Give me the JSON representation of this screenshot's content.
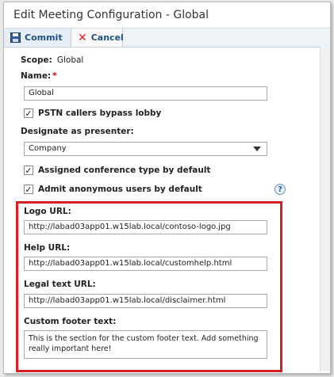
{
  "window": {
    "title": "Edit Meeting Configuration - Global"
  },
  "toolbar": {
    "commit_label": "Commit",
    "cancel_label": "Cancel"
  },
  "form": {
    "scope_label": "Scope:",
    "scope_value": "Global",
    "name_label": "Name:",
    "name_required_mark": "*",
    "name_value": "Global",
    "pstn_bypass": {
      "label": "PSTN callers bypass lobby",
      "checked": true
    },
    "designate_label": "Designate as presenter:",
    "designate_value": "Company",
    "assigned_conf": {
      "label": "Assigned conference type by default",
      "checked": true
    },
    "admit_anon": {
      "label": "Admit anonymous users by default",
      "checked": true
    },
    "help_glyph": "?",
    "logo_url_label": "Logo URL:",
    "logo_url_value": "http://labad03app01.w15lab.local/contoso-logo.jpg",
    "help_url_label": "Help URL:",
    "help_url_value": "http://labad03app01.w15lab.local/customhelp.html",
    "legal_url_label": "Legal text URL:",
    "legal_url_value": "http://labad03app01.w15lab.local/disclaimer.html",
    "footer_label": "Custom footer text:",
    "footer_value": "This is the section for the custom footer text.  Add something really important here!"
  },
  "colors": {
    "highlight": "#d81f26",
    "toolbar_text": "#1f4f86",
    "required": "#cc0000"
  },
  "icons": {
    "commit": "save-disk-icon",
    "cancel": "close-x-icon",
    "help": "help-question-icon",
    "dropdown": "chevron-down-icon"
  }
}
